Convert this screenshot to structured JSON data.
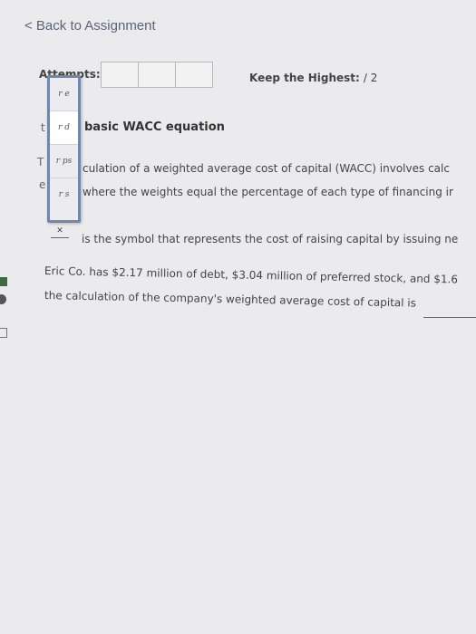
{
  "nav": {
    "back_label": "< Back to Assignment"
  },
  "attempts": {
    "label": "Attempts:",
    "boxes": 3
  },
  "keep": {
    "label": "Keep the Highest:",
    "score": "/ 2"
  },
  "dropdown": {
    "options": [
      "r_e",
      "r_d",
      "r_ps",
      "r_s"
    ],
    "display": [
      "r e",
      "r d",
      "r ps",
      "r s"
    ],
    "selected_index": 1
  },
  "question": {
    "heading": "basic WACC equation",
    "line1": "culation of a weighted average cost of capital (WACC) involves calc",
    "line2": "where the weights equal the percentage of each type of financing ir",
    "line3": "is the symbol that represents the cost of raising capital by issuing ne",
    "line4": "Eric Co. has $2.17 million of debt, $3.04 million of preferred stock, and $1.6",
    "line5": "the calculation of the company's weighted average cost of capital is"
  },
  "fragments": {
    "f1": "t",
    "f2": "T",
    "f3": "e",
    "f4": "_"
  }
}
